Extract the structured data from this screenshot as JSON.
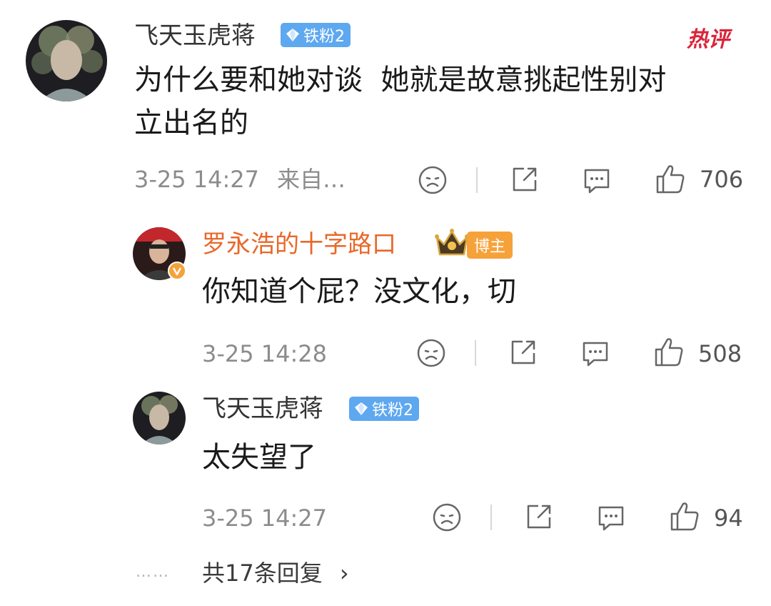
{
  "comment": {
    "username": "飞天玉虎蒋",
    "badge": "铁粉2",
    "hot_tag": "热评",
    "text_line1": "为什么要和她对谈  她就是故意挑起性别对",
    "text_line2": "立出名的",
    "timestamp": "3-25 14:27",
    "source": "来自…",
    "like_count": "706"
  },
  "replies": [
    {
      "username": "罗永浩的十字路口",
      "badge": "博主",
      "text": "你知道个屁？没文化，切",
      "timestamp": "3-25 14:28",
      "like_count": "508"
    },
    {
      "username": "飞天玉虎蒋",
      "badge": "铁粉2",
      "text": "太失望了",
      "timestamp": "3-25 14:27",
      "like_count": "94"
    }
  ],
  "more_replies": {
    "dots": "……",
    "label": "共17条回复",
    "chevron": "›"
  },
  "icons": {
    "dislike": "sad-face-icon",
    "share": "share-icon",
    "comment": "comment-bubble-icon",
    "like": "thumbs-up-icon",
    "verified": "verified-v-icon",
    "crown": "crown-icon"
  },
  "colors": {
    "blogger_name": "#e8682a",
    "fan_badge": "#5ea8f0",
    "blogger_badge": "#f6a23a",
    "hot_tag": "#d9253b",
    "meta_gray": "#8c8c8c"
  }
}
